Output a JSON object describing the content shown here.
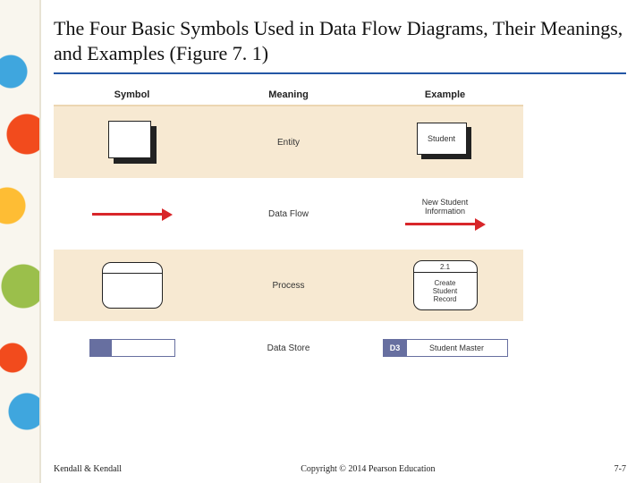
{
  "title": "The Four Basic Symbols Used in Data Flow Diagrams, Their Meanings, and Examples (Figure 7. 1)",
  "headers": {
    "c1": "Symbol",
    "c2": "Meaning",
    "c3": "Example"
  },
  "rows": {
    "entity": {
      "meaning": "Entity",
      "example_label": "Student"
    },
    "flow": {
      "meaning": "Data Flow",
      "example_label": "New Student\nInformation"
    },
    "process": {
      "meaning": "Process",
      "example_num": "2.1",
      "example_label": "Create\nStudent\nRecord"
    },
    "store": {
      "meaning": "Data Store",
      "example_tab": "D3",
      "example_label": "Student Master"
    }
  },
  "footer": {
    "left": "Kendall & Kendall",
    "center": "Copyright © 2014 Pearson Education",
    "right": "7-7"
  }
}
